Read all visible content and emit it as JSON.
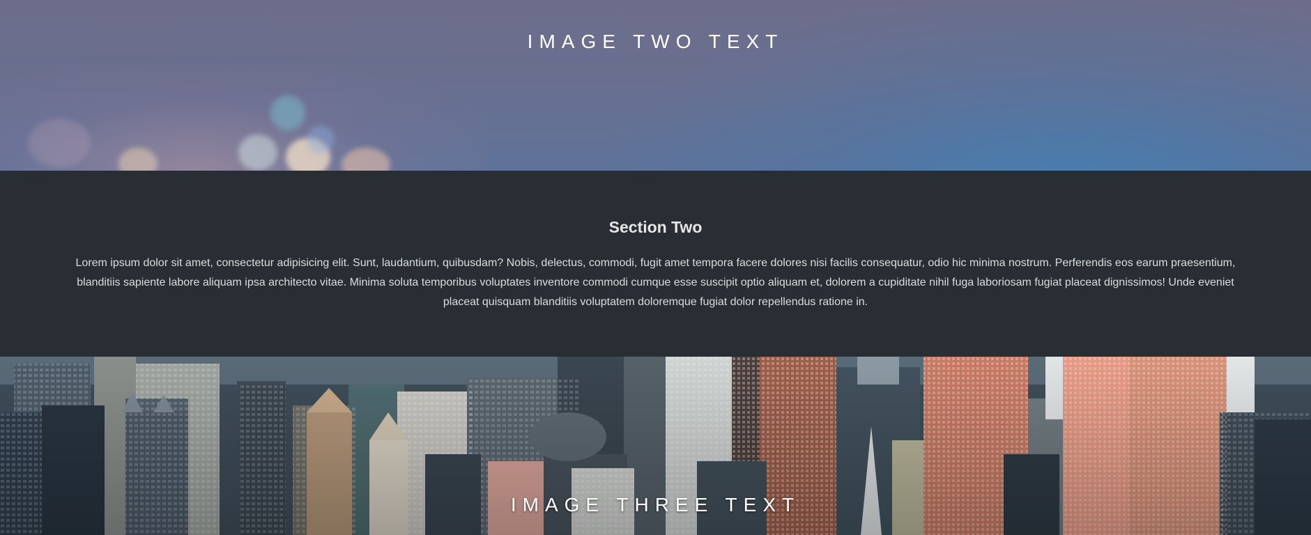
{
  "parallax_two": {
    "text": "IMAGE TWO TEXT"
  },
  "section_two": {
    "heading": "Section Two",
    "body": "Lorem ipsum dolor sit amet, consectetur adipisicing elit. Sunt, laudantium, quibusdam? Nobis, delectus, commodi, fugit amet tempora facere dolores nisi facilis consequatur, odio hic minima nostrum. Perferendis eos earum praesentium, blanditiis sapiente labore aliquam ipsa architecto vitae. Minima soluta temporibus voluptates inventore commodi cumque esse suscipit optio aliquam et, dolorem a cupiditate nihil fuga laboriosam fugiat placeat dignissimos! Unde eveniet placeat quisquam blanditiis voluptatem doloremque fugiat dolor repellendus ratione in."
  },
  "parallax_three": {
    "text": "IMAGE THREE TEXT"
  },
  "colors": {
    "section_background": "#282e34",
    "text_light": "#ffffff"
  }
}
